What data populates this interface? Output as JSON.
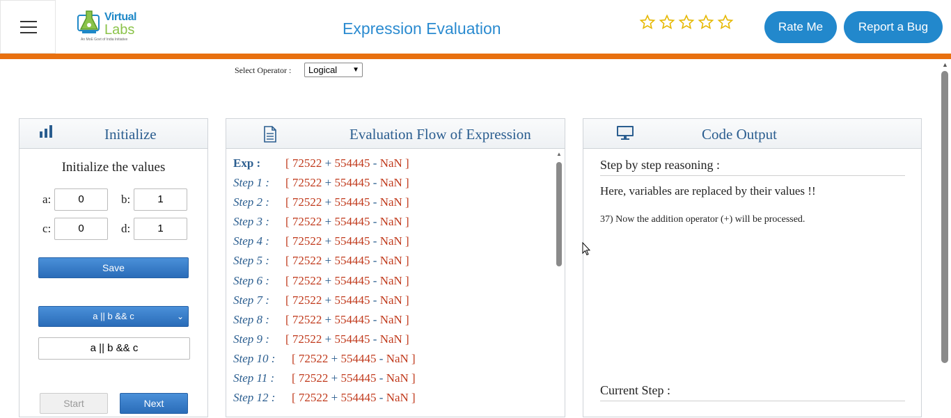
{
  "header": {
    "logo": {
      "line1": "Virtual",
      "line2": "Labs",
      "tagline": "An MoE Govt of India Initiative"
    },
    "title": "Expression Evaluation",
    "rating_stars": 5,
    "rating_value": 0,
    "rate_button": "Rate Me",
    "bug_button": "Report a Bug"
  },
  "operator": {
    "label": "Select Operator :",
    "selected": "Logical"
  },
  "initialize": {
    "title": "Initialize",
    "subtitle": "Initialize the values",
    "vars": [
      {
        "name": "a:",
        "value": "0"
      },
      {
        "name": "b:",
        "value": "1"
      },
      {
        "name": "c:",
        "value": "0"
      },
      {
        "name": "d:",
        "value": "1"
      }
    ],
    "save_label": "Save",
    "expression_selected": "a || b && c",
    "expression_input": "a || b && c",
    "start_label": "Start",
    "next_label": "Next"
  },
  "flow": {
    "title": "Evaluation Flow of Expression",
    "rows": [
      {
        "label": "Exp :",
        "n1": "72522",
        "op1": "+",
        "n2": "554445",
        "op2": "-",
        "n3": "NaN"
      },
      {
        "label": "Step 1 :",
        "n1": "72522",
        "op1": "+",
        "n2": "554445",
        "op2": "-",
        "n3": "NaN"
      },
      {
        "label": "Step 2 :",
        "n1": "72522",
        "op1": "+",
        "n2": "554445",
        "op2": "-",
        "n3": "NaN"
      },
      {
        "label": "Step 3 :",
        "n1": "72522",
        "op1": "+",
        "n2": "554445",
        "op2": "-",
        "n3": "NaN"
      },
      {
        "label": "Step 4 :",
        "n1": "72522",
        "op1": "+",
        "n2": "554445",
        "op2": "-",
        "n3": "NaN"
      },
      {
        "label": "Step 5 :",
        "n1": "72522",
        "op1": "+",
        "n2": "554445",
        "op2": "-",
        "n3": "NaN"
      },
      {
        "label": "Step 6 :",
        "n1": "72522",
        "op1": "+",
        "n2": "554445",
        "op2": "-",
        "n3": "NaN"
      },
      {
        "label": "Step 7 :",
        "n1": "72522",
        "op1": "+",
        "n2": "554445",
        "op2": "-",
        "n3": "NaN"
      },
      {
        "label": "Step 8 :",
        "n1": "72522",
        "op1": "+",
        "n2": "554445",
        "op2": "-",
        "n3": "NaN"
      },
      {
        "label": "Step 9 :",
        "n1": "72522",
        "op1": "+",
        "n2": "554445",
        "op2": "-",
        "n3": "NaN"
      },
      {
        "label": "Step 10 :",
        "n1": "72522",
        "op1": "+",
        "n2": "554445",
        "op2": "-",
        "n3": "NaN"
      },
      {
        "label": "Step 11 :",
        "n1": "72522",
        "op1": "+",
        "n2": "554445",
        "op2": "-",
        "n3": "NaN"
      },
      {
        "label": "Step 12 :",
        "n1": "72522",
        "op1": "+",
        "n2": "554445",
        "op2": "-",
        "n3": "NaN"
      }
    ]
  },
  "output": {
    "title": "Code Output",
    "reasoning_heading": "Step by step reasoning :",
    "reasoning_line1": "Here, variables are replaced by their values !!",
    "reasoning_line2": "37) Now the addition operator (+) will be processed.",
    "current_step_heading": "Current Step :"
  },
  "colors": {
    "accent": "#2288cc",
    "header_bar": "#e8700f",
    "panel_title": "#2a5d8f",
    "expr_red": "#c0391b"
  }
}
